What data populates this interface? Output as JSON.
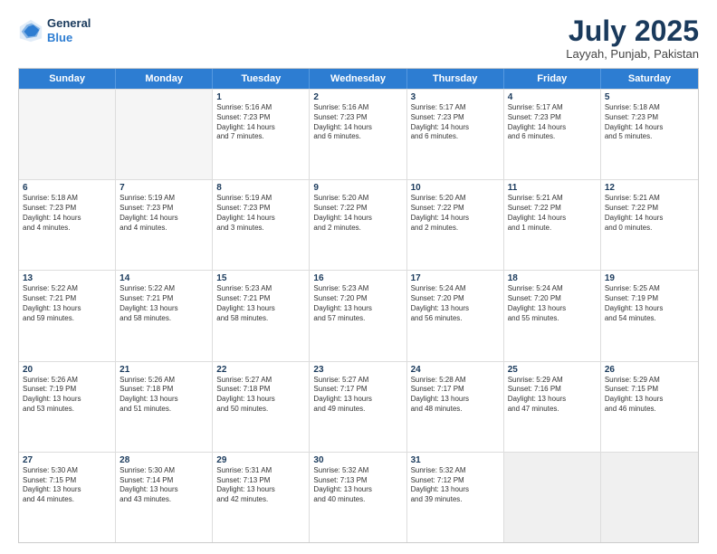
{
  "logo": {
    "line1": "General",
    "line2": "Blue"
  },
  "title": "July 2025",
  "subtitle": "Layyah, Punjab, Pakistan",
  "days": [
    "Sunday",
    "Monday",
    "Tuesday",
    "Wednesday",
    "Thursday",
    "Friday",
    "Saturday"
  ],
  "weeks": [
    [
      {
        "day": "",
        "lines": []
      },
      {
        "day": "",
        "lines": []
      },
      {
        "day": "1",
        "lines": [
          "Sunrise: 5:16 AM",
          "Sunset: 7:23 PM",
          "Daylight: 14 hours",
          "and 7 minutes."
        ]
      },
      {
        "day": "2",
        "lines": [
          "Sunrise: 5:16 AM",
          "Sunset: 7:23 PM",
          "Daylight: 14 hours",
          "and 6 minutes."
        ]
      },
      {
        "day": "3",
        "lines": [
          "Sunrise: 5:17 AM",
          "Sunset: 7:23 PM",
          "Daylight: 14 hours",
          "and 6 minutes."
        ]
      },
      {
        "day": "4",
        "lines": [
          "Sunrise: 5:17 AM",
          "Sunset: 7:23 PM",
          "Daylight: 14 hours",
          "and 6 minutes."
        ]
      },
      {
        "day": "5",
        "lines": [
          "Sunrise: 5:18 AM",
          "Sunset: 7:23 PM",
          "Daylight: 14 hours",
          "and 5 minutes."
        ]
      }
    ],
    [
      {
        "day": "6",
        "lines": [
          "Sunrise: 5:18 AM",
          "Sunset: 7:23 PM",
          "Daylight: 14 hours",
          "and 4 minutes."
        ]
      },
      {
        "day": "7",
        "lines": [
          "Sunrise: 5:19 AM",
          "Sunset: 7:23 PM",
          "Daylight: 14 hours",
          "and 4 minutes."
        ]
      },
      {
        "day": "8",
        "lines": [
          "Sunrise: 5:19 AM",
          "Sunset: 7:23 PM",
          "Daylight: 14 hours",
          "and 3 minutes."
        ]
      },
      {
        "day": "9",
        "lines": [
          "Sunrise: 5:20 AM",
          "Sunset: 7:22 PM",
          "Daylight: 14 hours",
          "and 2 minutes."
        ]
      },
      {
        "day": "10",
        "lines": [
          "Sunrise: 5:20 AM",
          "Sunset: 7:22 PM",
          "Daylight: 14 hours",
          "and 2 minutes."
        ]
      },
      {
        "day": "11",
        "lines": [
          "Sunrise: 5:21 AM",
          "Sunset: 7:22 PM",
          "Daylight: 14 hours",
          "and 1 minute."
        ]
      },
      {
        "day": "12",
        "lines": [
          "Sunrise: 5:21 AM",
          "Sunset: 7:22 PM",
          "Daylight: 14 hours",
          "and 0 minutes."
        ]
      }
    ],
    [
      {
        "day": "13",
        "lines": [
          "Sunrise: 5:22 AM",
          "Sunset: 7:21 PM",
          "Daylight: 13 hours",
          "and 59 minutes."
        ]
      },
      {
        "day": "14",
        "lines": [
          "Sunrise: 5:22 AM",
          "Sunset: 7:21 PM",
          "Daylight: 13 hours",
          "and 58 minutes."
        ]
      },
      {
        "day": "15",
        "lines": [
          "Sunrise: 5:23 AM",
          "Sunset: 7:21 PM",
          "Daylight: 13 hours",
          "and 58 minutes."
        ]
      },
      {
        "day": "16",
        "lines": [
          "Sunrise: 5:23 AM",
          "Sunset: 7:20 PM",
          "Daylight: 13 hours",
          "and 57 minutes."
        ]
      },
      {
        "day": "17",
        "lines": [
          "Sunrise: 5:24 AM",
          "Sunset: 7:20 PM",
          "Daylight: 13 hours",
          "and 56 minutes."
        ]
      },
      {
        "day": "18",
        "lines": [
          "Sunrise: 5:24 AM",
          "Sunset: 7:20 PM",
          "Daylight: 13 hours",
          "and 55 minutes."
        ]
      },
      {
        "day": "19",
        "lines": [
          "Sunrise: 5:25 AM",
          "Sunset: 7:19 PM",
          "Daylight: 13 hours",
          "and 54 minutes."
        ]
      }
    ],
    [
      {
        "day": "20",
        "lines": [
          "Sunrise: 5:26 AM",
          "Sunset: 7:19 PM",
          "Daylight: 13 hours",
          "and 53 minutes."
        ]
      },
      {
        "day": "21",
        "lines": [
          "Sunrise: 5:26 AM",
          "Sunset: 7:18 PM",
          "Daylight: 13 hours",
          "and 51 minutes."
        ]
      },
      {
        "day": "22",
        "lines": [
          "Sunrise: 5:27 AM",
          "Sunset: 7:18 PM",
          "Daylight: 13 hours",
          "and 50 minutes."
        ]
      },
      {
        "day": "23",
        "lines": [
          "Sunrise: 5:27 AM",
          "Sunset: 7:17 PM",
          "Daylight: 13 hours",
          "and 49 minutes."
        ]
      },
      {
        "day": "24",
        "lines": [
          "Sunrise: 5:28 AM",
          "Sunset: 7:17 PM",
          "Daylight: 13 hours",
          "and 48 minutes."
        ]
      },
      {
        "day": "25",
        "lines": [
          "Sunrise: 5:29 AM",
          "Sunset: 7:16 PM",
          "Daylight: 13 hours",
          "and 47 minutes."
        ]
      },
      {
        "day": "26",
        "lines": [
          "Sunrise: 5:29 AM",
          "Sunset: 7:15 PM",
          "Daylight: 13 hours",
          "and 46 minutes."
        ]
      }
    ],
    [
      {
        "day": "27",
        "lines": [
          "Sunrise: 5:30 AM",
          "Sunset: 7:15 PM",
          "Daylight: 13 hours",
          "and 44 minutes."
        ]
      },
      {
        "day": "28",
        "lines": [
          "Sunrise: 5:30 AM",
          "Sunset: 7:14 PM",
          "Daylight: 13 hours",
          "and 43 minutes."
        ]
      },
      {
        "day": "29",
        "lines": [
          "Sunrise: 5:31 AM",
          "Sunset: 7:13 PM",
          "Daylight: 13 hours",
          "and 42 minutes."
        ]
      },
      {
        "day": "30",
        "lines": [
          "Sunrise: 5:32 AM",
          "Sunset: 7:13 PM",
          "Daylight: 13 hours",
          "and 40 minutes."
        ]
      },
      {
        "day": "31",
        "lines": [
          "Sunrise: 5:32 AM",
          "Sunset: 7:12 PM",
          "Daylight: 13 hours",
          "and 39 minutes."
        ]
      },
      {
        "day": "",
        "lines": []
      },
      {
        "day": "",
        "lines": []
      }
    ]
  ]
}
